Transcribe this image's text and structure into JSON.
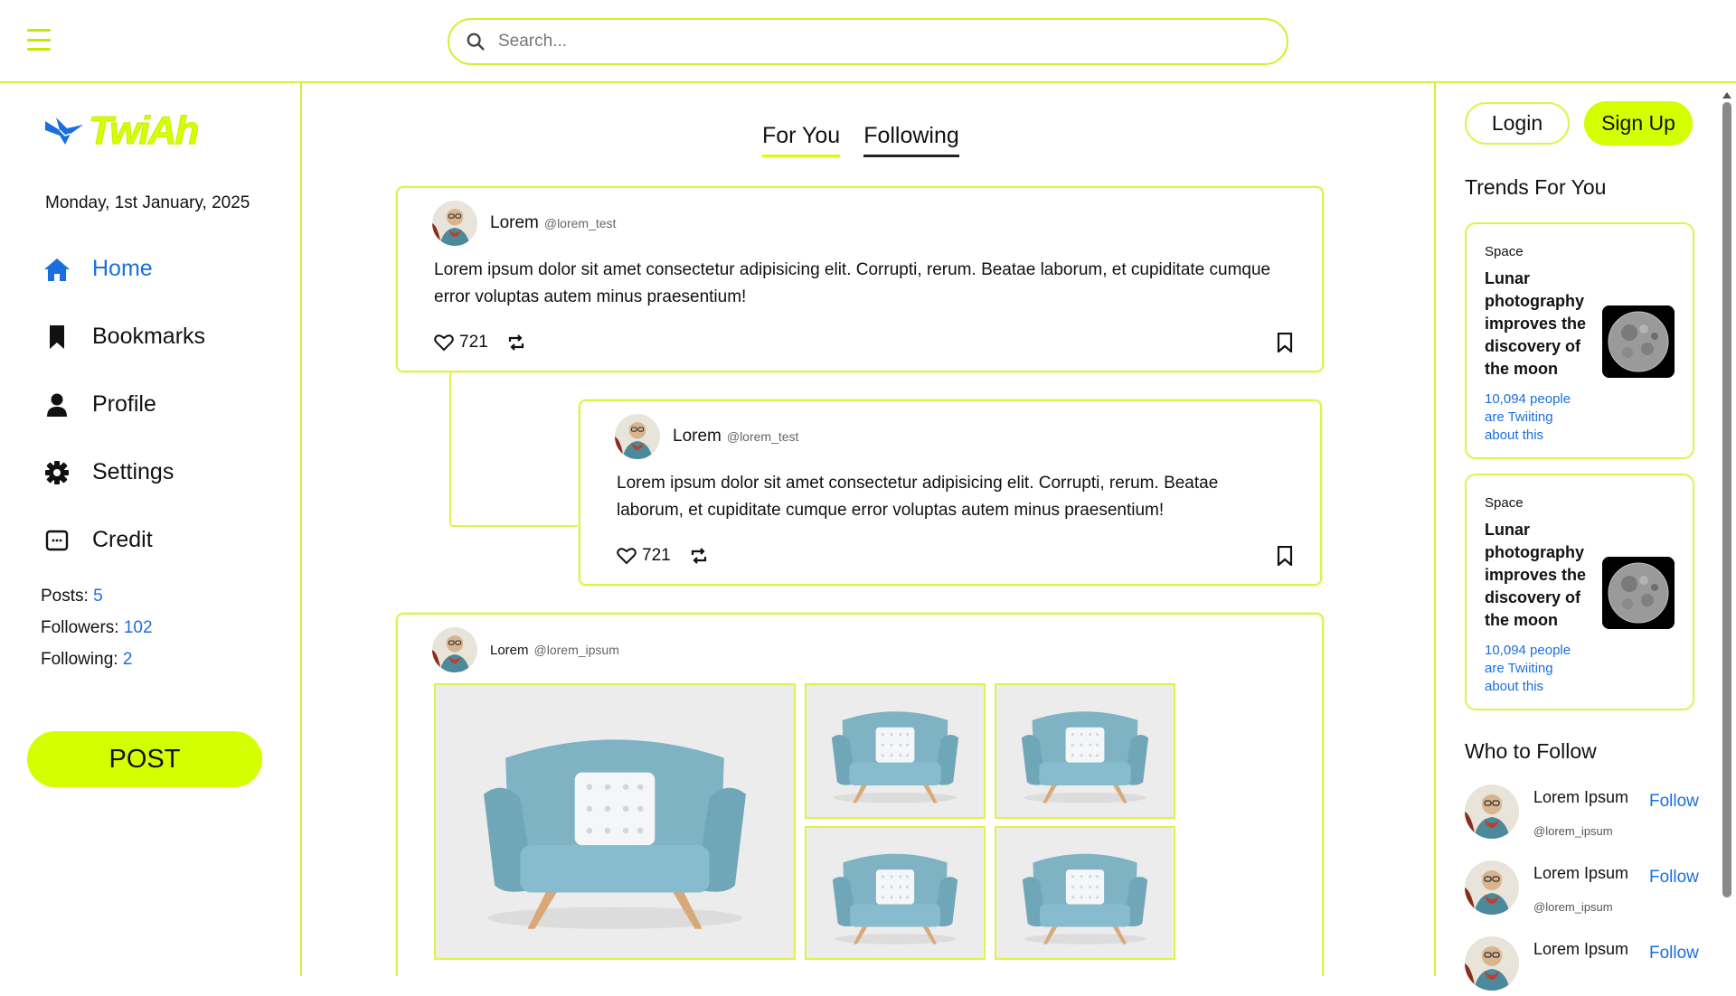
{
  "header": {
    "menu_icon": "hamburger-menu-icon",
    "search_placeholder": "Search...",
    "search_icon": "search-icon"
  },
  "sidebar": {
    "logo_text": "TwiAh",
    "date": "Monday, 1st January, 2025",
    "nav": [
      {
        "label": "Home",
        "icon": "home-icon",
        "active": true
      },
      {
        "label": "Bookmarks",
        "icon": "bookmark-icon",
        "active": false
      },
      {
        "label": "Profile",
        "icon": "user-icon",
        "active": false
      },
      {
        "label": "Settings",
        "icon": "gear-icon",
        "active": false
      },
      {
        "label": "Credit",
        "icon": "credit-card-icon",
        "active": false
      }
    ],
    "stats": {
      "posts_label": "Posts:",
      "posts": "5",
      "followers_label": "Followers:",
      "followers": "102",
      "following_label": "Following:",
      "following": "2"
    },
    "post_button": "POST"
  },
  "feed": {
    "tabs": [
      {
        "label": "For You"
      },
      {
        "label": "Following"
      }
    ],
    "posts": [
      {
        "name": "Lorem",
        "handle": "@lorem_test",
        "text": "Lorem ipsum dolor sit amet consectetur adipisicing elit. Corrupti, rerum. Beatae laborum, et cupiditate cumque error voluptas autem minus praesentium!",
        "likes": "721"
      },
      {
        "name": "Lorem",
        "handle": "@lorem_test",
        "text": "Lorem ipsum dolor sit amet consectetur adipisicing elit. Corrupti, rerum. Beatae laborum, et cupiditate cumque error voluptas autem minus praesentium!",
        "likes": "721"
      },
      {
        "name": "Lorem",
        "handle": "@lorem_ipsum"
      }
    ]
  },
  "right": {
    "login": "Login",
    "signup": "Sign Up",
    "trends_title": "Trends For You",
    "trends": [
      {
        "category": "Space",
        "title": "Lunar photography improves the discovery of the moon",
        "count": "10,094 people are Twiiting about this"
      },
      {
        "category": "Space",
        "title": "Lunar photography improves the discovery of the moon",
        "count": "10,094 people are Twiiting about this"
      }
    ],
    "who_title": "Who to Follow",
    "follow": [
      {
        "name": "Lorem Ipsum",
        "handle": "@lorem_ipsum",
        "action": "Follow"
      },
      {
        "name": "Lorem Ipsum",
        "handle": "@lorem_ipsum",
        "action": "Follow"
      },
      {
        "name": "Lorem Ipsum",
        "handle": "",
        "action": "Follow"
      }
    ]
  },
  "colors": {
    "accent": "#d4ff00",
    "link": "#1a6fe0"
  }
}
